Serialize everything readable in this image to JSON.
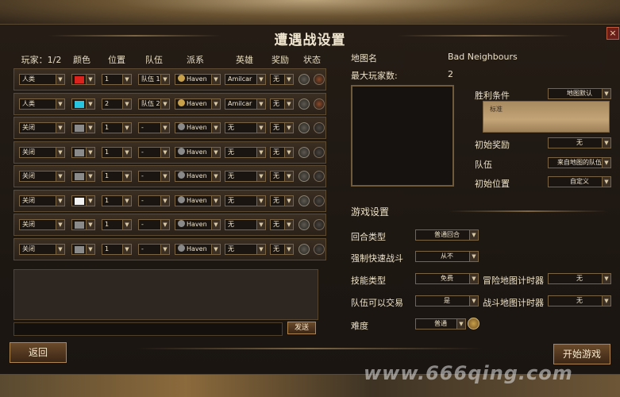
{
  "window": {
    "title": "遭遇战设置",
    "close_glyph": "×"
  },
  "headers": {
    "players": "玩家：1/2",
    "color": "颜色",
    "position": "位置",
    "team": "队伍",
    "faction": "派系",
    "hero": "英雄",
    "bonus": "奖励",
    "status": "状态"
  },
  "colors": {
    "red": "#d9231c",
    "cyan": "#27c5e0",
    "grey": "#8a8a8a",
    "white": "#f2f2f2",
    "gold": "#c9a14a"
  },
  "rows": [
    {
      "player": "人类",
      "position": "1",
      "team": "队伍 1",
      "faction": "Haven",
      "hero": "Amilcar",
      "bonus": "无"
    },
    {
      "player": "人类",
      "position": "2",
      "team": "队伍 2",
      "faction": "Haven",
      "hero": "Amilcar",
      "bonus": "无"
    },
    {
      "player": "关闭",
      "position": "1",
      "team": "-",
      "faction": "Haven",
      "hero": "无",
      "bonus": "无"
    },
    {
      "player": "关闭",
      "position": "1",
      "team": "-",
      "faction": "Haven",
      "hero": "无",
      "bonus": "无"
    },
    {
      "player": "关闭",
      "position": "1",
      "team": "-",
      "faction": "Haven",
      "hero": "无",
      "bonus": "无"
    },
    {
      "player": "关闭",
      "position": "1",
      "team": "-",
      "faction": "Haven",
      "hero": "无",
      "bonus": "无"
    },
    {
      "player": "关闭",
      "position": "1",
      "team": "-",
      "faction": "Haven",
      "hero": "无",
      "bonus": "无"
    },
    {
      "player": "关闭",
      "position": "1",
      "team": "-",
      "faction": "Haven",
      "hero": "无",
      "bonus": "无"
    }
  ],
  "chat": {
    "send_label": "发送"
  },
  "map": {
    "name_label": "地图名",
    "name_value": "Bad Neighbours",
    "max_players_label": "最大玩家数:",
    "max_players_value": "2"
  },
  "map_settings": {
    "victory_label": "胜利条件",
    "victory_value": "地图默认",
    "victory_text": "标准",
    "start_bonus_label": "初始奖励",
    "start_bonus_value": "无",
    "team_label": "队伍",
    "team_value": "来自地图的队伍",
    "start_pos_label": "初始位置",
    "start_pos_value": "自定义"
  },
  "game_settings": {
    "heading": "游戏设置",
    "turn_type_label": "回合类型",
    "turn_type_value": "普通回合",
    "quick_combat_label": "强制快速战斗",
    "quick_combat_value": "从不",
    "skill_type_label": "技能类型",
    "skill_type_value": "免费",
    "adv_timer_label": "冒险地图计时器",
    "adv_timer_value": "无",
    "trade_label": "队伍可以交易",
    "trade_value": "是",
    "combat_timer_label": "战斗地图计时器",
    "combat_timer_value": "无",
    "difficulty_label": "难度",
    "difficulty_value": "普通"
  },
  "footer": {
    "back_label": "返回",
    "start_label": "开始游戏"
  },
  "watermark": "www.666qing.com"
}
